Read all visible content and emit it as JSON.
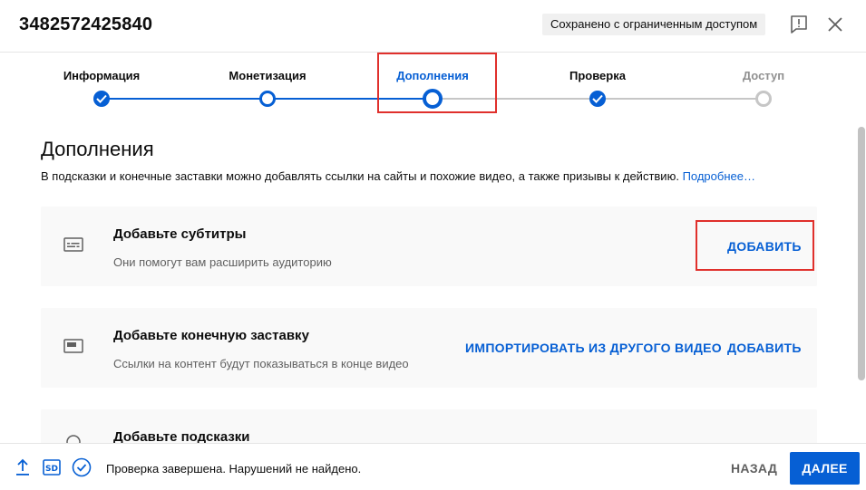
{
  "header": {
    "video_id": "3482572425840",
    "saved_status": "Сохранено с ограниченным доступом",
    "feedback_icon": "feedback-icon",
    "close_icon": "close-icon"
  },
  "stepper": {
    "steps": [
      {
        "label": "Информация",
        "state": "done"
      },
      {
        "label": "Монетизация",
        "state": "open"
      },
      {
        "label": "Дополнения",
        "state": "current"
      },
      {
        "label": "Проверка",
        "state": "done"
      },
      {
        "label": "Доступ",
        "state": "pending"
      }
    ]
  },
  "main": {
    "title": "Дополнения",
    "description": "В подсказки и конечные заставки можно добавлять ссылки на сайты и похожие видео, а также призывы к действию.",
    "learn_more": "Подробнее…",
    "cards": [
      {
        "icon": "subtitles-icon",
        "title": "Добавьте субтитры",
        "subtitle": "Они помогут вам расширить аудиторию",
        "add_label": "ДОБАВИТЬ"
      },
      {
        "icon": "end-screen-icon",
        "title": "Добавьте конечную заставку",
        "subtitle": "Ссылки на контент будут показываться в конце видео",
        "import_label": "ИМПОРТИРОВАТЬ ИЗ ДРУГОГО ВИДЕО",
        "add_label": "ДОБАВИТЬ"
      },
      {
        "icon": "cards-icon",
        "title": "Добавьте подсказки"
      }
    ]
  },
  "footer": {
    "icons": [
      "upload-icon",
      "sd-icon",
      "check-circle-icon"
    ],
    "status": "Проверка завершена. Нарушений не найдено.",
    "back_label": "НАЗАД",
    "next_label": "ДАЛЕЕ"
  },
  "colors": {
    "accent": "#065fd4",
    "highlight": "#e0302c",
    "pending": "#c6c6c6"
  }
}
